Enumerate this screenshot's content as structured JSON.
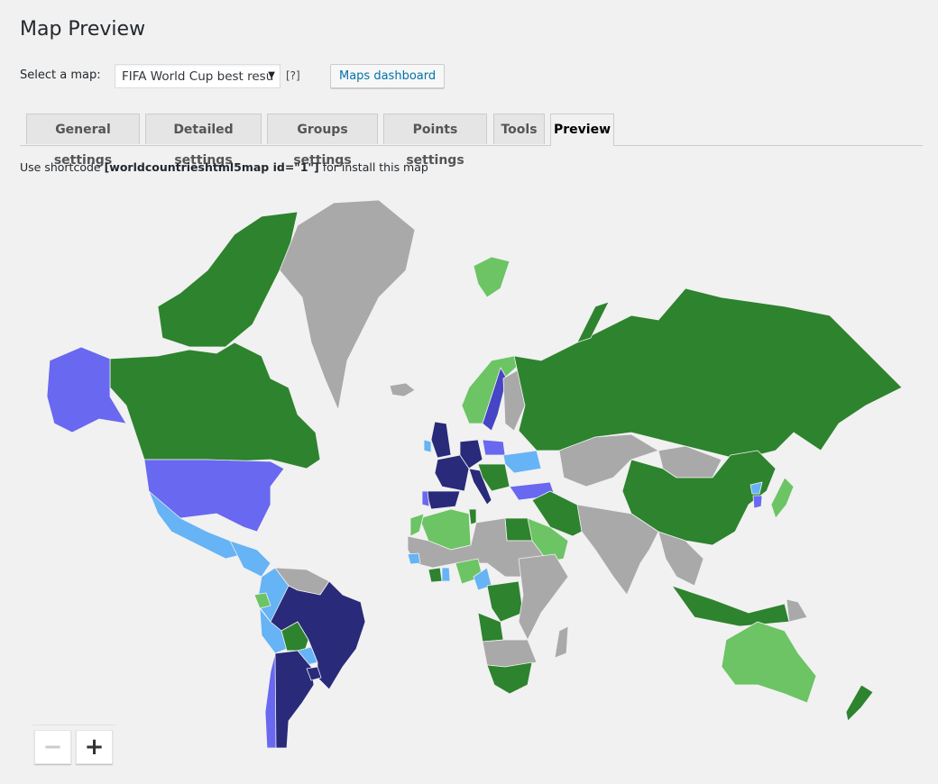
{
  "page": {
    "title": "Map Preview"
  },
  "selector": {
    "label": "Select a map:",
    "selected": "FIFA World Cup best resu",
    "arrow": "▼",
    "help": "[?]",
    "dashboard_button": "Maps dashboard"
  },
  "tabs": [
    {
      "label": "General settings",
      "active": false
    },
    {
      "label": "Detailed settings",
      "active": false
    },
    {
      "label": "Groups settings",
      "active": false
    },
    {
      "label": "Points settings",
      "active": false
    },
    {
      "label": "Tools",
      "active": false
    },
    {
      "label": "Preview",
      "active": true
    }
  ],
  "shortcode": {
    "prefix": "Use shortcode ",
    "code": "[worldcountrieshtml5map id=\"1\"]",
    "suffix": " for install this map"
  },
  "zoom": {
    "minus": "−",
    "plus": "+"
  },
  "legend_colors": {
    "winner": "#2a2a7a",
    "final": "#4545c5",
    "semifinal": "#6868f0",
    "quarterfinal": "#66b3f5",
    "round_of_16": "#6cc464",
    "group_stage": "#2e832e",
    "never": "#a9a9a9",
    "ocean": "#f1f1f1"
  },
  "map": {
    "regions": [
      {
        "name": "canada",
        "group": "group_stage"
      },
      {
        "name": "canada-arctic",
        "group": "group_stage"
      },
      {
        "name": "alaska",
        "group": "semifinal"
      },
      {
        "name": "usa",
        "group": "semifinal"
      },
      {
        "name": "mexico",
        "group": "quarterfinal"
      },
      {
        "name": "greenland",
        "group": "never"
      },
      {
        "name": "iceland",
        "group": "never"
      },
      {
        "name": "central-america",
        "group": "quarterfinal"
      },
      {
        "name": "colombia",
        "group": "quarterfinal"
      },
      {
        "name": "venezuela-guianas",
        "group": "never"
      },
      {
        "name": "ecuador",
        "group": "round_of_16"
      },
      {
        "name": "peru",
        "group": "quarterfinal"
      },
      {
        "name": "brazil",
        "group": "winner"
      },
      {
        "name": "bolivia",
        "group": "group_stage"
      },
      {
        "name": "paraguay",
        "group": "quarterfinal"
      },
      {
        "name": "argentina",
        "group": "winner"
      },
      {
        "name": "uruguay",
        "group": "winner"
      },
      {
        "name": "chile",
        "group": "semifinal"
      },
      {
        "name": "norway",
        "group": "round_of_16"
      },
      {
        "name": "sweden",
        "group": "final"
      },
      {
        "name": "finland",
        "group": "never"
      },
      {
        "name": "uk",
        "group": "winner"
      },
      {
        "name": "ireland",
        "group": "quarterfinal"
      },
      {
        "name": "france",
        "group": "winner"
      },
      {
        "name": "spain",
        "group": "winner"
      },
      {
        "name": "portugal",
        "group": "semifinal"
      },
      {
        "name": "germany",
        "group": "winner"
      },
      {
        "name": "italy",
        "group": "winner"
      },
      {
        "name": "poland",
        "group": "semifinal"
      },
      {
        "name": "ukraine",
        "group": "quarterfinal"
      },
      {
        "name": "balkans",
        "group": "group_stage"
      },
      {
        "name": "turkey",
        "group": "semifinal"
      },
      {
        "name": "russia",
        "group": "group_stage"
      },
      {
        "name": "novaya-zemlya",
        "group": "group_stage"
      },
      {
        "name": "svalbard",
        "group": "round_of_16"
      },
      {
        "name": "kazakhstan-central-asia",
        "group": "never"
      },
      {
        "name": "mongolia",
        "group": "never"
      },
      {
        "name": "china",
        "group": "group_stage"
      },
      {
        "name": "north-korea",
        "group": "quarterfinal"
      },
      {
        "name": "south-korea",
        "group": "semifinal"
      },
      {
        "name": "japan",
        "group": "round_of_16"
      },
      {
        "name": "iran-iraq",
        "group": "group_stage"
      },
      {
        "name": "saudi-arabia",
        "group": "round_of_16"
      },
      {
        "name": "india-south-asia",
        "group": "never"
      },
      {
        "name": "southeast-asia",
        "group": "never"
      },
      {
        "name": "indonesia",
        "group": "group_stage"
      },
      {
        "name": "papua-new-guinea",
        "group": "never"
      },
      {
        "name": "australia",
        "group": "round_of_16"
      },
      {
        "name": "new-zealand",
        "group": "group_stage"
      },
      {
        "name": "algeria",
        "group": "round_of_16"
      },
      {
        "name": "morocco",
        "group": "round_of_16"
      },
      {
        "name": "tunisia",
        "group": "group_stage"
      },
      {
        "name": "egypt",
        "group": "group_stage"
      },
      {
        "name": "sahara-sahel",
        "group": "never"
      },
      {
        "name": "senegal",
        "group": "quarterfinal"
      },
      {
        "name": "ivory-coast",
        "group": "group_stage"
      },
      {
        "name": "ghana",
        "group": "quarterfinal"
      },
      {
        "name": "nigeria",
        "group": "round_of_16"
      },
      {
        "name": "cameroon",
        "group": "quarterfinal"
      },
      {
        "name": "dr-congo",
        "group": "group_stage"
      },
      {
        "name": "angola",
        "group": "group_stage"
      },
      {
        "name": "east-africa",
        "group": "never"
      },
      {
        "name": "southern-africa",
        "group": "never"
      },
      {
        "name": "south-africa",
        "group": "group_stage"
      },
      {
        "name": "madagascar",
        "group": "never"
      }
    ]
  }
}
